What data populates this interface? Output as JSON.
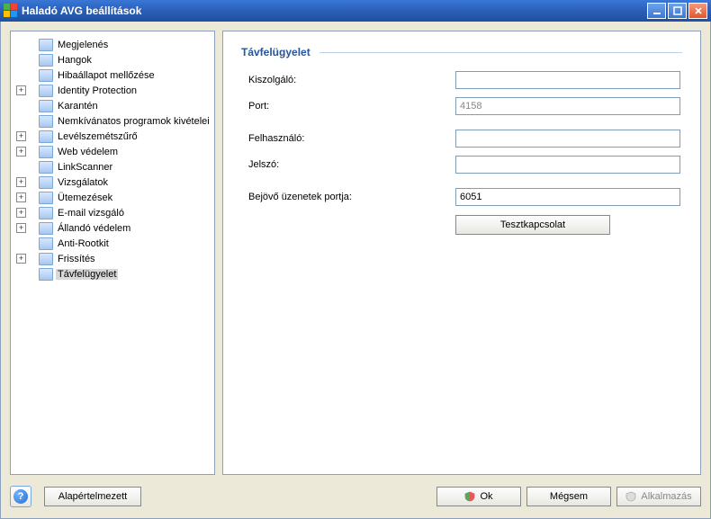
{
  "window": {
    "title": "Haladó AVG beállítások"
  },
  "tree": {
    "items": [
      {
        "label": "Megjelenés",
        "expandable": false
      },
      {
        "label": "Hangok",
        "expandable": false
      },
      {
        "label": "Hibaállapot mellőzése",
        "expandable": false
      },
      {
        "label": "Identity Protection",
        "expandable": true
      },
      {
        "label": "Karantén",
        "expandable": false
      },
      {
        "label": "Nemkívánatos programok kivételei",
        "expandable": false
      },
      {
        "label": "Levélszemétszűrő",
        "expandable": true
      },
      {
        "label": "Web védelem",
        "expandable": true
      },
      {
        "label": "LinkScanner",
        "expandable": false
      },
      {
        "label": "Vizsgálatok",
        "expandable": true
      },
      {
        "label": "Ütemezések",
        "expandable": true
      },
      {
        "label": "E-mail vizsgáló",
        "expandable": true
      },
      {
        "label": "Állandó védelem",
        "expandable": true
      },
      {
        "label": "Anti-Rootkit",
        "expandable": false
      },
      {
        "label": "Frissítés",
        "expandable": true
      },
      {
        "label": "Távfelügyelet",
        "expandable": false,
        "selected": true
      }
    ]
  },
  "main": {
    "section_title": "Távfelügyelet",
    "fields": {
      "server_label": "Kiszolgáló:",
      "server_value": "",
      "port_label": "Port:",
      "port_value": "4158",
      "user_label": "Felhasználó:",
      "user_value": "",
      "password_label": "Jelszó:",
      "password_value": "",
      "incoming_port_label": "Bejövő üzenetek portja:",
      "incoming_port_value": "6051"
    },
    "test_button": "Tesztkapcsolat"
  },
  "buttons": {
    "default": "Alapértelmezett",
    "ok": "Ok",
    "cancel": "Mégsem",
    "apply": "Alkalmazás"
  }
}
